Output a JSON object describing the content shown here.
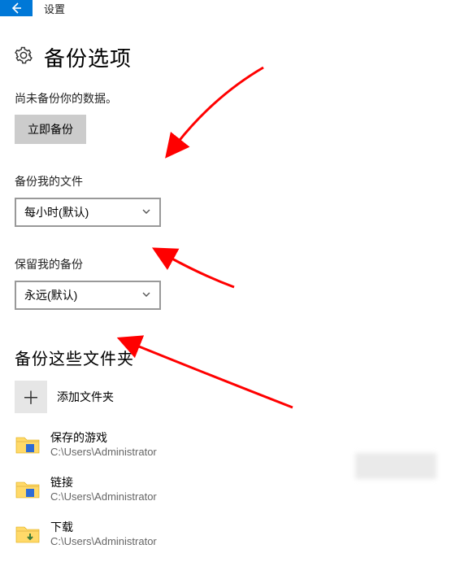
{
  "titlebar": {
    "app_title": "设置"
  },
  "header": {
    "page_title": "备份选项"
  },
  "status": {
    "text": "尚未备份你的数据。",
    "backup_now_label": "立即备份"
  },
  "frequency": {
    "label": "备份我的文件",
    "selected": "每小时(默认)"
  },
  "retention": {
    "label": "保留我的备份",
    "selected": "永远(默认)"
  },
  "folders_section": {
    "heading": "备份这些文件夹",
    "add_label": "添加文件夹",
    "items": [
      {
        "name": "保存的游戏",
        "path": "C:\\Users\\Administrator"
      },
      {
        "name": "链接",
        "path": "C:\\Users\\Administrator"
      },
      {
        "name": "下载",
        "path": "C:\\Users\\Administrator"
      }
    ]
  },
  "colors": {
    "accent": "#0078d7",
    "arrow": "#ff0000"
  }
}
